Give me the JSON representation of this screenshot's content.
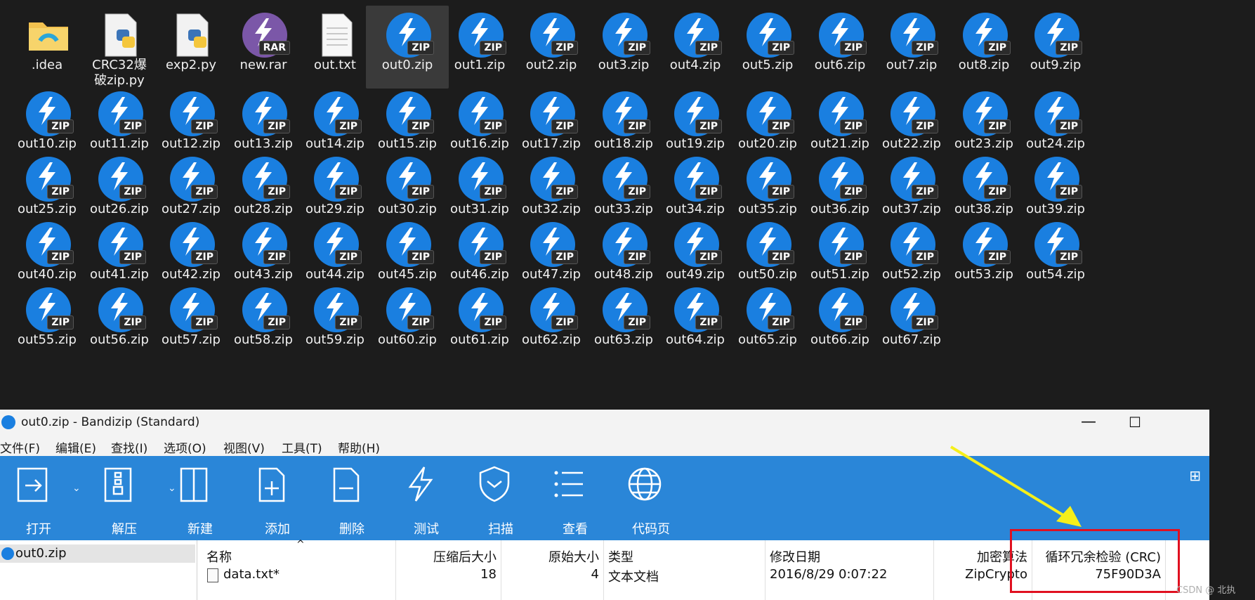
{
  "desktop": {
    "items": [
      {
        "name": ".idea",
        "type": "folder"
      },
      {
        "name": "CRC32爆\n破zip.py",
        "type": "python"
      },
      {
        "name": "exp2.py",
        "type": "python"
      },
      {
        "name": "new.rar",
        "type": "rar"
      },
      {
        "name": "out.txt",
        "type": "txt"
      },
      {
        "name": "out0.zip",
        "type": "zip",
        "selected": true
      },
      {
        "name": "out1.zip",
        "type": "zip"
      },
      {
        "name": "out2.zip",
        "type": "zip"
      },
      {
        "name": "out3.zip",
        "type": "zip"
      },
      {
        "name": "out4.zip",
        "type": "zip"
      },
      {
        "name": "out5.zip",
        "type": "zip"
      },
      {
        "name": "out6.zip",
        "type": "zip"
      },
      {
        "name": "out7.zip",
        "type": "zip"
      },
      {
        "name": "out8.zip",
        "type": "zip"
      },
      {
        "name": "out9.zip",
        "type": "zip"
      },
      {
        "name": "out10.zip",
        "type": "zip"
      },
      {
        "name": "out11.zip",
        "type": "zip"
      },
      {
        "name": "out12.zip",
        "type": "zip"
      },
      {
        "name": "out13.zip",
        "type": "zip"
      },
      {
        "name": "out14.zip",
        "type": "zip"
      },
      {
        "name": "out15.zip",
        "type": "zip"
      },
      {
        "name": "out16.zip",
        "type": "zip"
      },
      {
        "name": "out17.zip",
        "type": "zip"
      },
      {
        "name": "out18.zip",
        "type": "zip"
      },
      {
        "name": "out19.zip",
        "type": "zip"
      },
      {
        "name": "out20.zip",
        "type": "zip"
      },
      {
        "name": "out21.zip",
        "type": "zip"
      },
      {
        "name": "out22.zip",
        "type": "zip"
      },
      {
        "name": "out23.zip",
        "type": "zip"
      },
      {
        "name": "out24.zip",
        "type": "zip"
      },
      {
        "name": "out25.zip",
        "type": "zip"
      },
      {
        "name": "out26.zip",
        "type": "zip"
      },
      {
        "name": "out27.zip",
        "type": "zip"
      },
      {
        "name": "out28.zip",
        "type": "zip"
      },
      {
        "name": "out29.zip",
        "type": "zip"
      },
      {
        "name": "out30.zip",
        "type": "zip"
      },
      {
        "name": "out31.zip",
        "type": "zip"
      },
      {
        "name": "out32.zip",
        "type": "zip"
      },
      {
        "name": "out33.zip",
        "type": "zip"
      },
      {
        "name": "out34.zip",
        "type": "zip"
      },
      {
        "name": "out35.zip",
        "type": "zip"
      },
      {
        "name": "out36.zip",
        "type": "zip"
      },
      {
        "name": "out37.zip",
        "type": "zip"
      },
      {
        "name": "out38.zip",
        "type": "zip"
      },
      {
        "name": "out39.zip",
        "type": "zip"
      },
      {
        "name": "out40.zip",
        "type": "zip"
      },
      {
        "name": "out41.zip",
        "type": "zip"
      },
      {
        "name": "out42.zip",
        "type": "zip"
      },
      {
        "name": "out43.zip",
        "type": "zip"
      },
      {
        "name": "out44.zip",
        "type": "zip"
      },
      {
        "name": "out45.zip",
        "type": "zip"
      },
      {
        "name": "out46.zip",
        "type": "zip"
      },
      {
        "name": "out47.zip",
        "type": "zip"
      },
      {
        "name": "out48.zip",
        "type": "zip"
      },
      {
        "name": "out49.zip",
        "type": "zip"
      },
      {
        "name": "out50.zip",
        "type": "zip"
      },
      {
        "name": "out51.zip",
        "type": "zip"
      },
      {
        "name": "out52.zip",
        "type": "zip"
      },
      {
        "name": "out53.zip",
        "type": "zip"
      },
      {
        "name": "out54.zip",
        "type": "zip"
      },
      {
        "name": "out55.zip",
        "type": "zip"
      },
      {
        "name": "out56.zip",
        "type": "zip"
      },
      {
        "name": "out57.zip",
        "type": "zip"
      },
      {
        "name": "out58.zip",
        "type": "zip"
      },
      {
        "name": "out59.zip",
        "type": "zip"
      },
      {
        "name": "out60.zip",
        "type": "zip"
      },
      {
        "name": "out61.zip",
        "type": "zip"
      },
      {
        "name": "out62.zip",
        "type": "zip"
      },
      {
        "name": "out63.zip",
        "type": "zip"
      },
      {
        "name": "out64.zip",
        "type": "zip"
      },
      {
        "name": "out65.zip",
        "type": "zip"
      },
      {
        "name": "out66.zip",
        "type": "zip"
      },
      {
        "name": "out67.zip",
        "type": "zip"
      }
    ],
    "zip_tag": "ZIP",
    "rar_tag": "RAR"
  },
  "window": {
    "title": "out0.zip - Bandizip (Standard)",
    "minimize": "—",
    "maximize": "☐",
    "close": "✕"
  },
  "menu": [
    "文件(F)",
    "编辑(E)",
    "查找(I)",
    "选项(O)",
    "视图(V)",
    "工具(T)",
    "帮助(H)"
  ],
  "toolbar": {
    "buttons": [
      {
        "label": "打开",
        "icon": "open-icon"
      },
      {
        "label": "解压",
        "icon": "extract-icon"
      },
      {
        "label": "新建",
        "icon": "new-archive-icon"
      },
      {
        "label": "添加",
        "icon": "add-icon"
      },
      {
        "label": "删除",
        "icon": "delete-icon"
      },
      {
        "label": "测试",
        "icon": "test-icon"
      },
      {
        "label": "扫描",
        "icon": "scan-icon"
      },
      {
        "label": "查看",
        "icon": "view-icon"
      },
      {
        "label": "代码页",
        "icon": "codepage-icon"
      }
    ],
    "dropdown_glyph": "⌄",
    "layout_glyph": "⊞"
  },
  "tree": {
    "root": "out0.zip"
  },
  "list": {
    "columns": [
      "名称",
      "压缩后大小",
      "原始大小",
      "类型",
      "修改日期",
      "加密算法",
      "循环冗余检验 (CRC)"
    ],
    "sort_glyph": "^",
    "rows": [
      {
        "name": "data.txt*",
        "compressed": "18",
        "original": "4",
        "type": "文本文档",
        "modified": "2016/8/29 0:07:22",
        "encryption": "ZipCrypto",
        "crc": "75F90D3A"
      }
    ]
  },
  "colors": {
    "desktop_bg": "#1c1c1c",
    "toolbar_bg": "#2a86d8",
    "zip_blue": "#1a7fe0",
    "highlight_red": "#e01020",
    "arrow_yellow": "#f5ef1a"
  },
  "watermark": "CSDN @    北执"
}
